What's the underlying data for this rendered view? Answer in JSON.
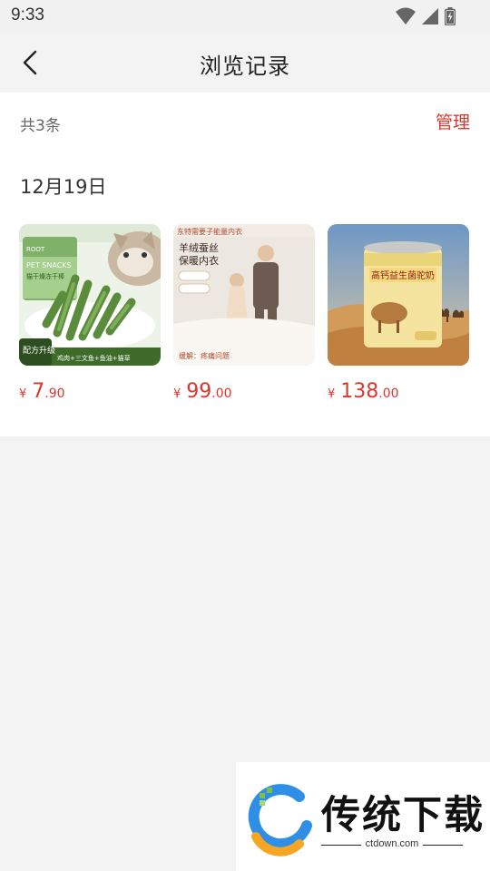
{
  "status_bar": {
    "time": "9:33"
  },
  "nav": {
    "title": "浏览记录",
    "back_icon": "chevron-left-icon"
  },
  "summary": {
    "count_text": "共3条",
    "manage_label": "管理"
  },
  "groups": [
    {
      "date": "12月19日",
      "items": [
        {
          "price_symbol": "¥",
          "price_int": "7",
          "price_dec": ".90",
          "image": {
            "brand_tag": "ROOT",
            "title": "PET SNACKS",
            "subtitle": "猫干燥冻干棒",
            "badge": "配方升级",
            "footer": "鸡肉+三文鱼+鱼油+猫草"
          }
        },
        {
          "price_symbol": "¥",
          "price_int": "99",
          "price_dec": ".00",
          "image": {
            "title": "羊绒蚕丝",
            "title2": "保暖内衣",
            "banner": "东特需要子能量内衣",
            "footer": "缓解：疼痛问题"
          }
        },
        {
          "price_symbol": "¥",
          "price_int": "138",
          "price_dec": ".00",
          "image": {
            "title": "高钙益生菌驼奶"
          }
        }
      ]
    }
  ],
  "watermark": {
    "text": "传统下载",
    "url": "ctdown.com"
  },
  "colors": {
    "accent": "#e0352b",
    "page_bg": "#f3f3f3",
    "card_bg": "#ffffff"
  }
}
